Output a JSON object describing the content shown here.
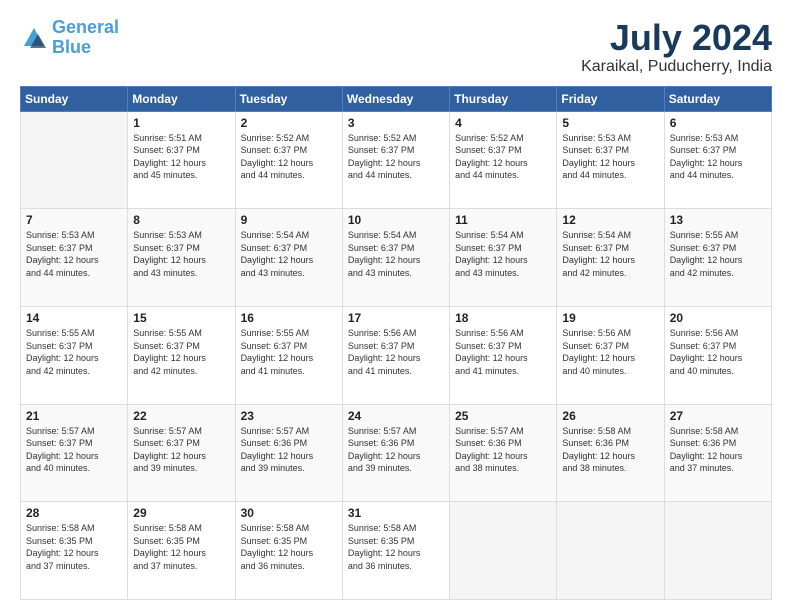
{
  "logo": {
    "line1": "General",
    "line2": "Blue"
  },
  "title": "July 2024",
  "subtitle": "Karaikal, Puducherry, India",
  "days_header": [
    "Sunday",
    "Monday",
    "Tuesday",
    "Wednesday",
    "Thursday",
    "Friday",
    "Saturday"
  ],
  "weeks": [
    [
      {
        "day": "",
        "info": ""
      },
      {
        "day": "1",
        "info": "Sunrise: 5:51 AM\nSunset: 6:37 PM\nDaylight: 12 hours\nand 45 minutes."
      },
      {
        "day": "2",
        "info": "Sunrise: 5:52 AM\nSunset: 6:37 PM\nDaylight: 12 hours\nand 44 minutes."
      },
      {
        "day": "3",
        "info": "Sunrise: 5:52 AM\nSunset: 6:37 PM\nDaylight: 12 hours\nand 44 minutes."
      },
      {
        "day": "4",
        "info": "Sunrise: 5:52 AM\nSunset: 6:37 PM\nDaylight: 12 hours\nand 44 minutes."
      },
      {
        "day": "5",
        "info": "Sunrise: 5:53 AM\nSunset: 6:37 PM\nDaylight: 12 hours\nand 44 minutes."
      },
      {
        "day": "6",
        "info": "Sunrise: 5:53 AM\nSunset: 6:37 PM\nDaylight: 12 hours\nand 44 minutes."
      }
    ],
    [
      {
        "day": "7",
        "info": "Sunrise: 5:53 AM\nSunset: 6:37 PM\nDaylight: 12 hours\nand 44 minutes."
      },
      {
        "day": "8",
        "info": "Sunrise: 5:53 AM\nSunset: 6:37 PM\nDaylight: 12 hours\nand 43 minutes."
      },
      {
        "day": "9",
        "info": "Sunrise: 5:54 AM\nSunset: 6:37 PM\nDaylight: 12 hours\nand 43 minutes."
      },
      {
        "day": "10",
        "info": "Sunrise: 5:54 AM\nSunset: 6:37 PM\nDaylight: 12 hours\nand 43 minutes."
      },
      {
        "day": "11",
        "info": "Sunrise: 5:54 AM\nSunset: 6:37 PM\nDaylight: 12 hours\nand 43 minutes."
      },
      {
        "day": "12",
        "info": "Sunrise: 5:54 AM\nSunset: 6:37 PM\nDaylight: 12 hours\nand 42 minutes."
      },
      {
        "day": "13",
        "info": "Sunrise: 5:55 AM\nSunset: 6:37 PM\nDaylight: 12 hours\nand 42 minutes."
      }
    ],
    [
      {
        "day": "14",
        "info": "Sunrise: 5:55 AM\nSunset: 6:37 PM\nDaylight: 12 hours\nand 42 minutes."
      },
      {
        "day": "15",
        "info": "Sunrise: 5:55 AM\nSunset: 6:37 PM\nDaylight: 12 hours\nand 42 minutes."
      },
      {
        "day": "16",
        "info": "Sunrise: 5:55 AM\nSunset: 6:37 PM\nDaylight: 12 hours\nand 41 minutes."
      },
      {
        "day": "17",
        "info": "Sunrise: 5:56 AM\nSunset: 6:37 PM\nDaylight: 12 hours\nand 41 minutes."
      },
      {
        "day": "18",
        "info": "Sunrise: 5:56 AM\nSunset: 6:37 PM\nDaylight: 12 hours\nand 41 minutes."
      },
      {
        "day": "19",
        "info": "Sunrise: 5:56 AM\nSunset: 6:37 PM\nDaylight: 12 hours\nand 40 minutes."
      },
      {
        "day": "20",
        "info": "Sunrise: 5:56 AM\nSunset: 6:37 PM\nDaylight: 12 hours\nand 40 minutes."
      }
    ],
    [
      {
        "day": "21",
        "info": "Sunrise: 5:57 AM\nSunset: 6:37 PM\nDaylight: 12 hours\nand 40 minutes."
      },
      {
        "day": "22",
        "info": "Sunrise: 5:57 AM\nSunset: 6:37 PM\nDaylight: 12 hours\nand 39 minutes."
      },
      {
        "day": "23",
        "info": "Sunrise: 5:57 AM\nSunset: 6:36 PM\nDaylight: 12 hours\nand 39 minutes."
      },
      {
        "day": "24",
        "info": "Sunrise: 5:57 AM\nSunset: 6:36 PM\nDaylight: 12 hours\nand 39 minutes."
      },
      {
        "day": "25",
        "info": "Sunrise: 5:57 AM\nSunset: 6:36 PM\nDaylight: 12 hours\nand 38 minutes."
      },
      {
        "day": "26",
        "info": "Sunrise: 5:58 AM\nSunset: 6:36 PM\nDaylight: 12 hours\nand 38 minutes."
      },
      {
        "day": "27",
        "info": "Sunrise: 5:58 AM\nSunset: 6:36 PM\nDaylight: 12 hours\nand 37 minutes."
      }
    ],
    [
      {
        "day": "28",
        "info": "Sunrise: 5:58 AM\nSunset: 6:35 PM\nDaylight: 12 hours\nand 37 minutes."
      },
      {
        "day": "29",
        "info": "Sunrise: 5:58 AM\nSunset: 6:35 PM\nDaylight: 12 hours\nand 37 minutes."
      },
      {
        "day": "30",
        "info": "Sunrise: 5:58 AM\nSunset: 6:35 PM\nDaylight: 12 hours\nand 36 minutes."
      },
      {
        "day": "31",
        "info": "Sunrise: 5:58 AM\nSunset: 6:35 PM\nDaylight: 12 hours\nand 36 minutes."
      },
      {
        "day": "",
        "info": ""
      },
      {
        "day": "",
        "info": ""
      },
      {
        "day": "",
        "info": ""
      }
    ]
  ]
}
